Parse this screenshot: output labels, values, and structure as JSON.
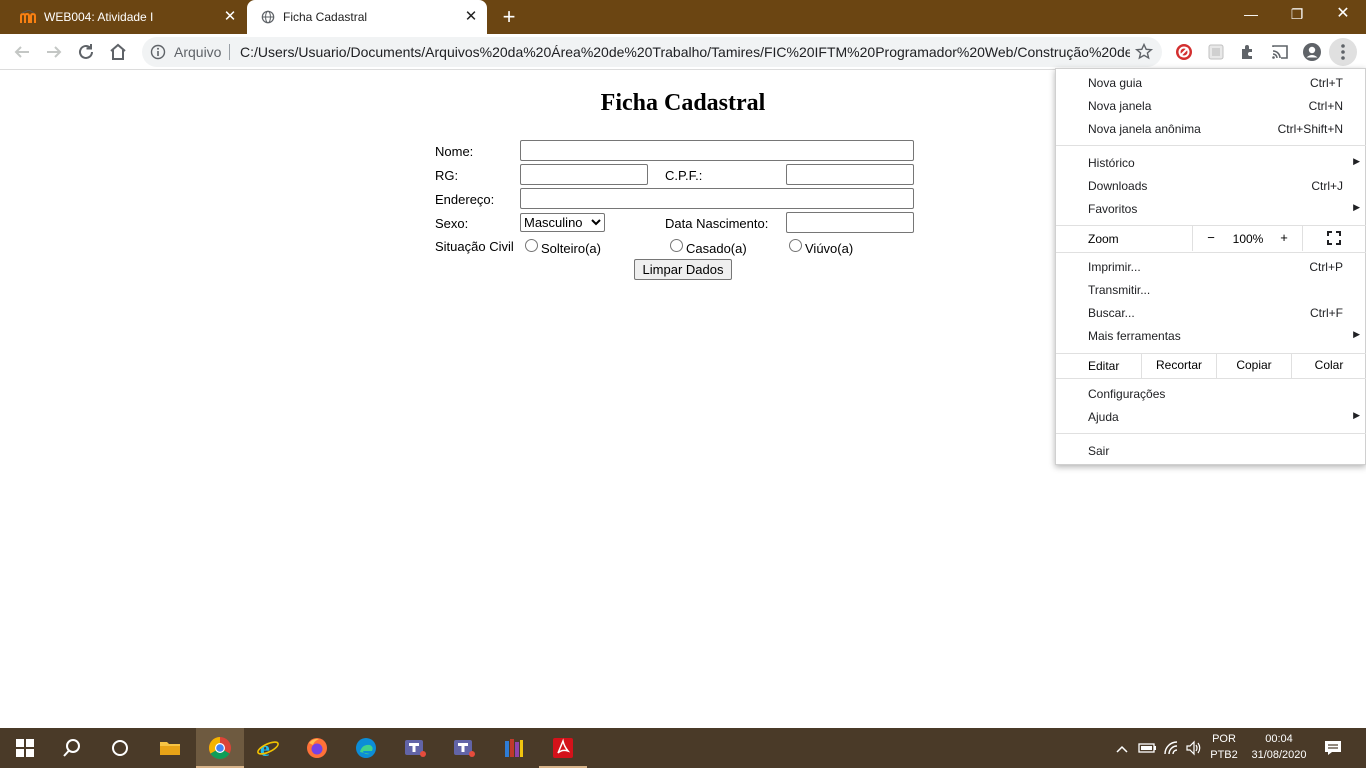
{
  "tabs": [
    {
      "title": "WEB004: Atividade I",
      "close": "✕"
    },
    {
      "title": "Ficha Cadastral",
      "close": "✕"
    }
  ],
  "new_tab": "+",
  "window_controls": {
    "minimize": "—",
    "restore": "❐",
    "close": "✕"
  },
  "address": {
    "scheme": "Arquivo",
    "url": "C:/Users/Usuario/Documents/Arquivos%20da%20Área%20de%20Trabalho/Tamires/FIC%20IFTM%20Programador%20Web/Construção%20de..."
  },
  "form": {
    "title": "Ficha Cadastral",
    "nome_label": "Nome:",
    "rg_label": "RG:",
    "cpf_label": "C.P.F.:",
    "endereco_label": "Endereço:",
    "sexo_label": "Sexo:",
    "sexo_value": "Masculino",
    "data_label": "Data Nascimento:",
    "situacao_label": "Situação Civil",
    "options": [
      "Solteiro(a)",
      "Casado(a)",
      "Viúvo(a)"
    ],
    "clear_button": "Limpar Dados"
  },
  "menu": {
    "new_tab": {
      "label": "Nova guia",
      "shortcut": "Ctrl+T"
    },
    "new_window": {
      "label": "Nova janela",
      "shortcut": "Ctrl+N"
    },
    "incognito": {
      "label": "Nova janela anônima",
      "shortcut": "Ctrl+Shift+N"
    },
    "history": {
      "label": "Histórico"
    },
    "downloads": {
      "label": "Downloads",
      "shortcut": "Ctrl+J"
    },
    "bookmarks": {
      "label": "Favoritos"
    },
    "zoom": {
      "label": "Zoom",
      "minus": "−",
      "value": "100%",
      "plus": "+"
    },
    "print": {
      "label": "Imprimir...",
      "shortcut": "Ctrl+P"
    },
    "cast": {
      "label": "Transmitir..."
    },
    "find": {
      "label": "Buscar...",
      "shortcut": "Ctrl+F"
    },
    "more_tools": {
      "label": "Mais ferramentas"
    },
    "edit": {
      "label": "Editar",
      "cut": "Recortar",
      "copy": "Copiar",
      "paste": "Colar"
    },
    "settings": {
      "label": "Configurações"
    },
    "help": {
      "label": "Ajuda"
    },
    "exit": {
      "label": "Sair"
    }
  },
  "tray": {
    "lang_top": "POR",
    "lang_bottom": "PTB2",
    "time": "00:04",
    "date": "31/08/2020"
  }
}
